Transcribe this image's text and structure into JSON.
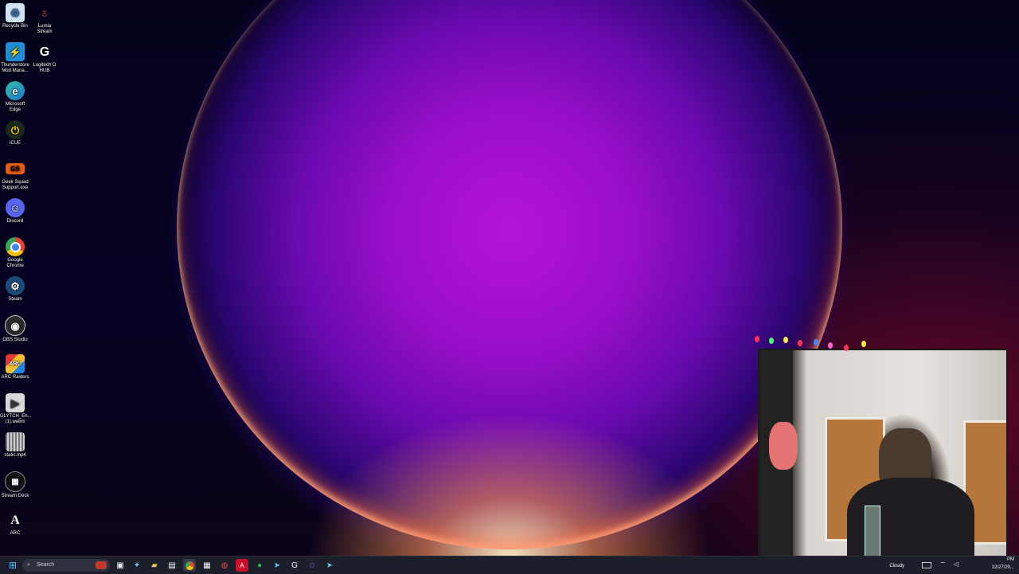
{
  "desktop": {
    "icons_col1": [
      {
        "label": "Recycle Bin",
        "icon": "recycle-bin-icon"
      },
      {
        "label": "Thunderstore\nMod Mana...",
        "icon": "thunderstore-icon"
      },
      {
        "label": "Microsoft\nEdge",
        "icon": "edge-icon"
      },
      {
        "label": "iCUE",
        "icon": "icue-icon"
      },
      {
        "label": "Geek Squad\nSupport.exe",
        "icon": "geek-squad-icon"
      },
      {
        "label": "Discord",
        "icon": "discord-icon"
      },
      {
        "label": "Google\nChrome",
        "icon": "chrome-icon"
      },
      {
        "label": "Steam",
        "icon": "steam-icon"
      },
      {
        "label": "OBS Studio",
        "icon": "obs-icon"
      },
      {
        "label": "ARC Raiders",
        "icon": "arc-raiders-icon"
      },
      {
        "label": "GLYTCH_En...\n(1).webm",
        "icon": "video-file-icon"
      },
      {
        "label": "static.mp4",
        "icon": "video-file-icon"
      },
      {
        "label": "Stream Deck",
        "icon": "stream-deck-icon"
      },
      {
        "label": "ARC",
        "icon": "arc-icon"
      }
    ],
    "icons_col2": [
      {
        "label": "Lumia\nStream",
        "icon": "lumia-stream-icon"
      },
      {
        "label": "Logitech G\nHUB",
        "icon": "logitech-ghub-icon"
      }
    ]
  },
  "taskbar": {
    "search_placeholder": "Search",
    "apps": [
      "start-icon",
      "task-view-icon",
      "copilot-icon",
      "file-explorer-icon",
      "store-icon",
      "chrome-icon",
      "app-icon",
      "app-icon",
      "adobe-icon",
      "spotify-icon",
      "steam-icon",
      "logitech-ghub-icon",
      "discord-icon",
      "steam-icon"
    ],
    "tray": {
      "weather": "Cloudy",
      "time": "PM",
      "date": "12/27/20..."
    }
  },
  "colors": {
    "taskbar_bg": "#1c1f2a",
    "accent": "#b414d6"
  }
}
